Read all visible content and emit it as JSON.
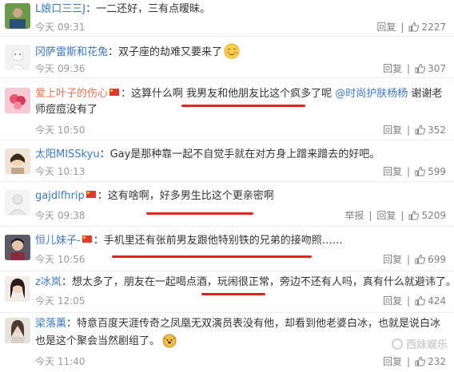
{
  "labels": {
    "reply": "回复",
    "report": "举报"
  },
  "comments": [
    {
      "user": "L娘口三三J",
      "text": "：一二还好，三有点暧昧。",
      "time": "今天 09:31",
      "likes": "2227"
    },
    {
      "user": "冈萨雷斯和花兔",
      "text": "：双子座的劫难又要来了",
      "time": "今天 09:36",
      "likes": "307"
    },
    {
      "user": "爱上叶子的伤心",
      "text_a": "：这算什么啊 我男友和他朋友比这个疯多了呢 ",
      "mention": "@时尚护肤杨杨",
      "text_b": " 谢谢老师痘痘没有了",
      "time": "今天 10:50",
      "likes": "352"
    },
    {
      "user": "太阳MISSkyu",
      "text": "：Gay是那种靠一起不自觉手就在对方身上蹭来蹭去的好吧。",
      "time": "今天 10:13",
      "likes": "599"
    },
    {
      "user": "gajdlfhrip",
      "text": "：这有啥啊，好多男生比这个更亲密啊",
      "time": "今天 09:38",
      "likes": "5209"
    },
    {
      "user": "恒儿妹子-",
      "text": "：手机里还有张前男友跟他特别铁的兄弟的接吻照……",
      "time": "今天 10:56",
      "likes": "699"
    },
    {
      "user": "z冰岚",
      "text": "：想太多了，朋友在一起喝点酒，玩闹很正常，旁边不还有人吗，真有什么就避讳了。",
      "time": "今天 12:05",
      "likes": "424"
    },
    {
      "user": "梁落薰",
      "text": "：特意百度天涯传奇之凤凰无双演员表没有他，却看到他老婆白冰，也就是说白冰也是这个聚会当然剧组了。",
      "time": "今天 11:40",
      "likes": "232"
    }
  ],
  "watermark": "西妹娱乐"
}
